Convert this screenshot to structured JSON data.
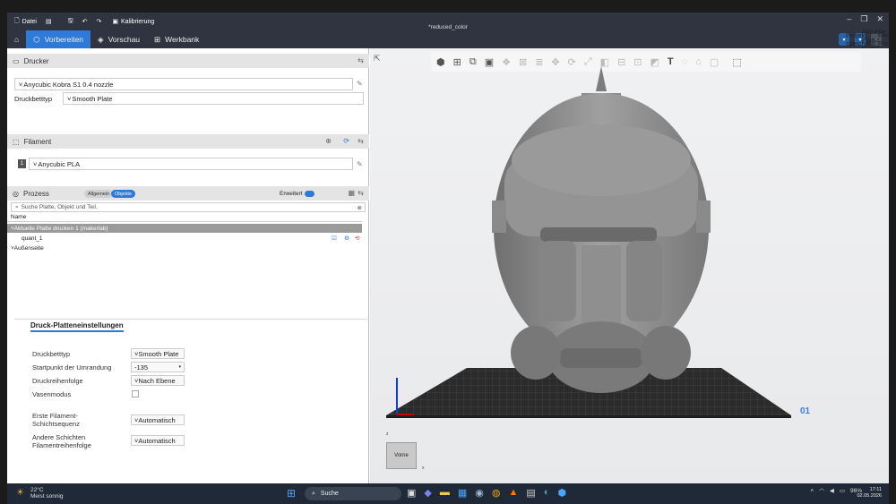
{
  "titlebar": {
    "file_menu": "Datei",
    "calibration": "Kalibrierung",
    "document_title": "*reduced_color"
  },
  "tabs": [
    {
      "label": "Vorbereiten",
      "active": true
    },
    {
      "label": "Vorschau",
      "active": false
    },
    {
      "label": "Werkbank",
      "active": false
    }
  ],
  "actions": {
    "save_project": "Projekt speichern",
    "slice_plate": "Aktuelle Platte slicen",
    "remote_print": "Remote Print"
  },
  "printer": {
    "header": "Drucker",
    "printer_value": "Anycubic Kobra S1 0.4 nozzle",
    "bed_type_label": "Druckbetttyp",
    "bed_type_value": "Smooth Plate"
  },
  "filament": {
    "header": "Filament",
    "slot_number": "1",
    "value": "Anycubic PLA"
  },
  "process": {
    "header": "Prozess",
    "mode_general": "Allgemein",
    "mode_objects": "Objekte",
    "advanced_label": "Erweitert",
    "search_placeholder": "Suche Platte, Objekt und Teil.",
    "column_name": "Name",
    "tree": {
      "plate_row": "Aktuelle Platte drucken 1 (makerlab)",
      "object_row": "quant_1",
      "outer_row": "Außenseite"
    }
  },
  "plate_settings": {
    "tab_label": "Druck-Platteneinstellungen",
    "rows": [
      {
        "label": "Druckbetttyp",
        "value": "Smooth Plate"
      },
      {
        "label": "Startpunkt der Umrandung",
        "value": "-135"
      },
      {
        "label": "Druckreihenfolge",
        "value": "Nach Ebene"
      },
      {
        "label": "Vasenmodus",
        "value": ""
      },
      {
        "label": "Erste Filament-Schichtsequenz",
        "value": "Automatisch"
      },
      {
        "label": "Andere Schichten Filamentreihenfolge",
        "value": "Automatisch"
      }
    ]
  },
  "viewport": {
    "view_cube_label": "Vorne",
    "axis_z": "z",
    "axis_x": "x",
    "plate_number": "01"
  },
  "taskbar": {
    "temperature": "22°C",
    "weather": "Meist sonnig",
    "search_label": "Suche",
    "battery": "96%",
    "time": "17:11",
    "date": "02.05.2026"
  },
  "colors": {
    "accent": "#2f7ad6",
    "titlebar": "#2f3440",
    "taskbar": "#1f2937",
    "plate": "#2b2b2b",
    "model": "#8c8c8c"
  }
}
